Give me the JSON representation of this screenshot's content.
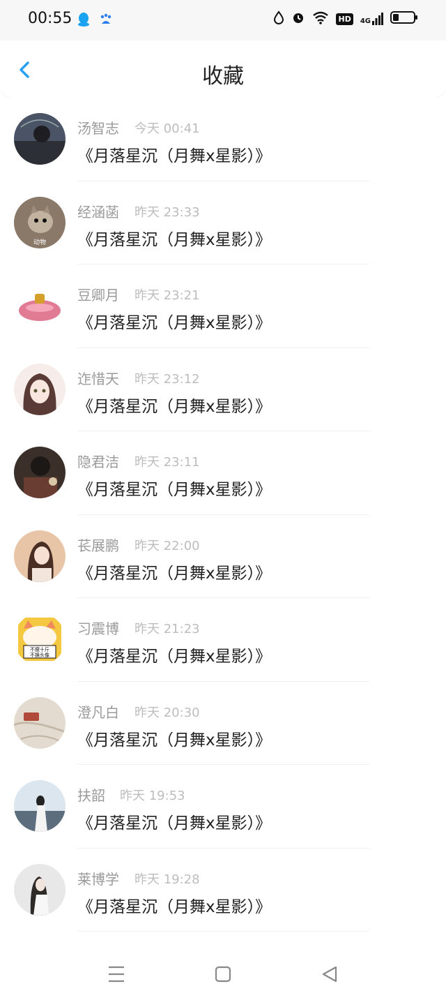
{
  "status_bar": {
    "time": "00:55",
    "network_badge": "HD",
    "signal_label": "4G"
  },
  "header": {
    "title": "收藏"
  },
  "favorites": [
    {
      "name": "汤智志",
      "time": "今天 00:41",
      "message": "《月落星沉（月舞x星影）》",
      "avatar_color": "#334"
    },
    {
      "name": "经涵菡",
      "time": "昨天 23:33",
      "message": "《月落星沉（月舞x星影）》",
      "avatar_color": "#7a6a5a",
      "avatar_text": "动物"
    },
    {
      "name": "豆卿月",
      "time": "昨天 23:21",
      "message": "《月落星沉（月舞x星影）》",
      "avatar_color": "#e07b93"
    },
    {
      "name": "迮惜天",
      "time": "昨天 23:12",
      "message": "《月落星沉（月舞x星影）》",
      "avatar_color": "#c9a8a0"
    },
    {
      "name": "隐君洁",
      "time": "昨天 23:11",
      "message": "《月落星沉（月舞x星影）》",
      "avatar_color": "#3b2f2a"
    },
    {
      "name": "苌展鹏",
      "time": "昨天 22:00",
      "message": "《月落星沉（月舞x星影）》",
      "avatar_color": "#e8b78e"
    },
    {
      "name": "习震博",
      "time": "昨天 21:23",
      "message": "《月落星沉（月舞x星影）》",
      "avatar_color": "#f5c842",
      "avatar_text": "不瘦十斤\n不换头像"
    },
    {
      "name": "澄凡白",
      "time": "昨天 20:30",
      "message": "《月落星沉（月舞x星影）》",
      "avatar_color": "#d8cfc4"
    },
    {
      "name": "扶韶",
      "time": "昨天 19:53",
      "message": "《月落星沉（月舞x星影）》",
      "avatar_color": "#b8cbd8"
    },
    {
      "name": "莱博学",
      "time": "昨天 19:28",
      "message": "《月落星沉（月舞x星影）》",
      "avatar_color": "#cfcfcf"
    }
  ],
  "colors": {
    "accent": "#2a9ff0",
    "name_gray": "#9a9a9a",
    "time_gray": "#bdbdbd"
  },
  "icons": {
    "back": "chevron-left-icon",
    "menu": "menu-icon",
    "home": "home-icon",
    "nav_back": "triangle-back-icon"
  }
}
